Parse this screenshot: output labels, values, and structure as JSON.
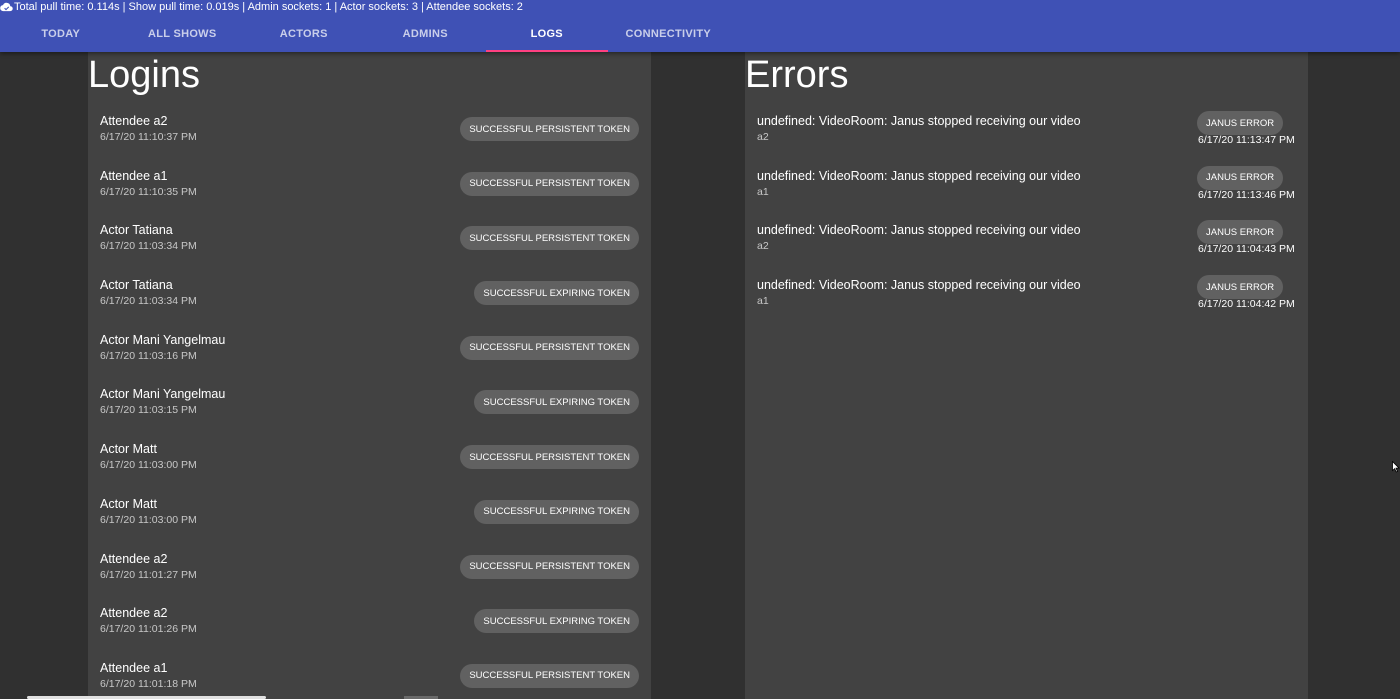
{
  "status": {
    "text": "Total pull time: 0.114s | Show pull time: 0.019s | Admin sockets: 1 | Actor sockets: 3 | Attendee sockets: 2",
    "icon": "cloud-check-icon"
  },
  "tabs": [
    {
      "label": "TODAY",
      "active": false
    },
    {
      "label": "ALL SHOWS",
      "active": false
    },
    {
      "label": "ACTORS",
      "active": false
    },
    {
      "label": "ADMINS",
      "active": false
    },
    {
      "label": "LOGS",
      "active": true
    },
    {
      "label": "CONNECTIVITY",
      "active": false
    }
  ],
  "colors": {
    "appbar": "#3f51b5",
    "tab_indicator": "#ff4081",
    "panel": "#424242",
    "background": "#303030",
    "chip": "#616161"
  },
  "logins": {
    "title": "Logins",
    "items": [
      {
        "name": "Attendee a2",
        "time": "6/17/20 11:10:37 PM",
        "status": "SUCCESSFUL PERSISTENT TOKEN"
      },
      {
        "name": "Attendee a1",
        "time": "6/17/20 11:10:35 PM",
        "status": "SUCCESSFUL PERSISTENT TOKEN"
      },
      {
        "name": "Actor Tatiana",
        "time": "6/17/20 11:03:34 PM",
        "status": "SUCCESSFUL PERSISTENT TOKEN"
      },
      {
        "name": "Actor Tatiana",
        "time": "6/17/20 11:03:34 PM",
        "status": "SUCCESSFUL EXPIRING TOKEN"
      },
      {
        "name": "Actor Mani Yangelmau",
        "time": "6/17/20 11:03:16 PM",
        "status": "SUCCESSFUL PERSISTENT TOKEN"
      },
      {
        "name": "Actor Mani Yangelmau",
        "time": "6/17/20 11:03:15 PM",
        "status": "SUCCESSFUL EXPIRING TOKEN"
      },
      {
        "name": "Actor Matt",
        "time": "6/17/20 11:03:00 PM",
        "status": "SUCCESSFUL PERSISTENT TOKEN"
      },
      {
        "name": "Actor Matt",
        "time": "6/17/20 11:03:00 PM",
        "status": "SUCCESSFUL EXPIRING TOKEN"
      },
      {
        "name": "Attendee a2",
        "time": "6/17/20 11:01:27 PM",
        "status": "SUCCESSFUL PERSISTENT TOKEN"
      },
      {
        "name": "Attendee a2",
        "time": "6/17/20 11:01:26 PM",
        "status": "SUCCESSFUL EXPIRING TOKEN"
      },
      {
        "name": "Attendee a1",
        "time": "6/17/20 11:01:18 PM",
        "status": "SUCCESSFUL PERSISTENT TOKEN"
      }
    ]
  },
  "errors": {
    "title": "Errors",
    "items": [
      {
        "message": "undefined: VideoRoom: Janus stopped receiving our video",
        "user": "a2",
        "type": "JANUS ERROR",
        "time": "6/17/20 11:13:47 PM"
      },
      {
        "message": "undefined: VideoRoom: Janus stopped receiving our video",
        "user": "a1",
        "type": "JANUS ERROR",
        "time": "6/17/20 11:13:46 PM"
      },
      {
        "message": "undefined: VideoRoom: Janus stopped receiving our video",
        "user": "a2",
        "type": "JANUS ERROR",
        "time": "6/17/20 11:04:43 PM"
      },
      {
        "message": "undefined: VideoRoom: Janus stopped receiving our video",
        "user": "a1",
        "type": "JANUS ERROR",
        "time": "6/17/20 11:04:42 PM"
      }
    ]
  }
}
